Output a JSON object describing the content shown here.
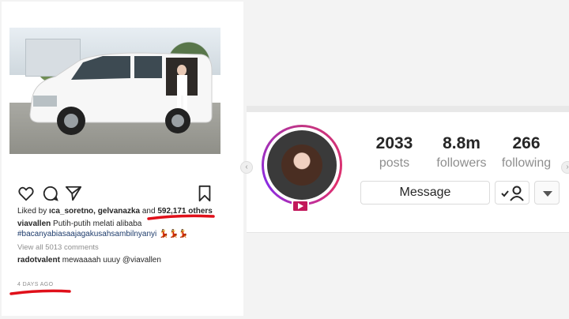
{
  "post": {
    "likes_prefix": "Liked by",
    "likes_users": "ıca_soretno, gelvanazka",
    "likes_and": "and",
    "likes_count": "592,171 others",
    "caption_user": "viavallen",
    "caption_text": "Putih-putih melati alibaba",
    "caption_hashtag": "#bacanyabiasaajagakusahsambilnyanyi",
    "caption_emoji": "💃💃💃",
    "view_comments": "View all 5013 comments",
    "comment_user": "radotvalent",
    "comment_text": "mewaaaah uuuy @viavallen",
    "time_ago": "4 DAYS AGO"
  },
  "profile": {
    "stats": [
      {
        "number": "2033",
        "label": "posts"
      },
      {
        "number": "8.8m",
        "label": "followers"
      },
      {
        "number": "266",
        "label": "following"
      }
    ],
    "message_button": "Message"
  },
  "icons": {
    "like": "heart-icon",
    "comment": "comment-bubble-icon",
    "share": "paper-plane-icon",
    "save": "bookmark-icon",
    "follow": "following-check-icon",
    "more": "chevron-down-icon",
    "live": "igtv-play-icon"
  },
  "colors": {
    "highlight_red": "#e0101a",
    "avatar_ring": "#c13584",
    "hashtag": "#1d3b6b"
  }
}
